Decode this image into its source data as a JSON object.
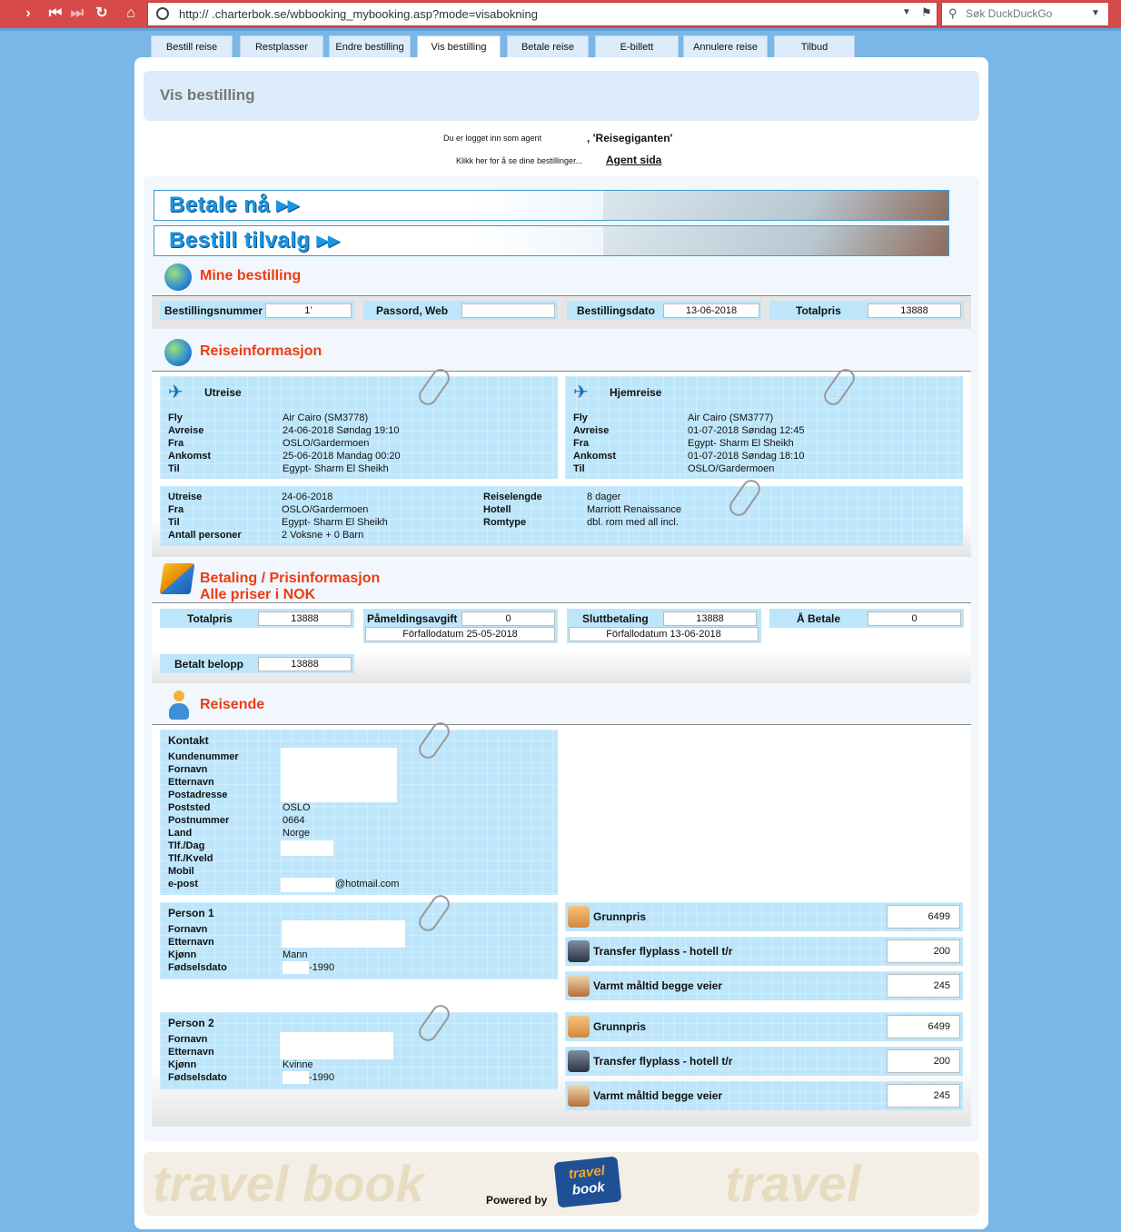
{
  "browser": {
    "url": "http://                     .charterbok.se/wbbooking_mybooking.asp?mode=visabokning",
    "search_placeholder": "Søk DuckDuckGo"
  },
  "tabs": [
    "Bestill reise",
    "Restplasser",
    "Endre bestilling",
    "Vis bestilling",
    "Betale reise",
    "E-billett",
    "Annulere reise",
    "Tilbud"
  ],
  "page_title": "Vis bestilling",
  "agent": {
    "logged_in_text": "Du er logget inn som agent",
    "agent_name": ", 'Reisegiganten'",
    "link_prompt": "Klikk her for å se dine bestillinger...",
    "link_text": "Agent sida"
  },
  "banners": {
    "pay_now": "Betale nå ▸▸",
    "order_extras": "Bestill tilvalg ▸▸"
  },
  "mine_bestilling": {
    "title": "Mine bestilling",
    "fields": [
      {
        "label": "Bestillingsnummer",
        "value": "1’"
      },
      {
        "label": "Passord, Web",
        "value": ""
      },
      {
        "label": "Bestillingsdato",
        "value": "13-06-2018"
      },
      {
        "label": "Totalpris",
        "value": "13888"
      }
    ]
  },
  "reiseinfo": {
    "title": "Reiseinformasjon",
    "utreise": {
      "heading": "Utreise",
      "labels": [
        "Fly",
        "Avreise",
        "Fra",
        "Ankomst",
        "Til"
      ],
      "values": [
        "Air Cairo (SM3778)",
        "24-06-2018 Søndag 19:10",
        "OSLO/Gardermoen",
        "25-06-2018 Mandag 00:20",
        "Egypt- Sharm El Sheikh"
      ]
    },
    "hjemreise": {
      "heading": "Hjemreise",
      "labels": [
        "Fly",
        "Avreise",
        "Fra",
        "Ankomst",
        "Til"
      ],
      "values": [
        "Air Cairo (SM3777)",
        "01-07-2018 Søndag 12:45",
        "Egypt- Sharm El Sheikh",
        "01-07-2018 Søndag 18:10",
        "OSLO/Gardermoen"
      ]
    },
    "summary_left": {
      "labels": [
        "Utreise",
        "Fra",
        "Til",
        "Antall personer"
      ],
      "values": [
        "24-06-2018",
        "OSLO/Gardermoen",
        "Egypt- Sharm El Sheikh",
        "2 Voksne + 0 Barn"
      ]
    },
    "summary_right": {
      "labels": [
        "Reiselengde",
        "Hotell",
        "Romtype"
      ],
      "values": [
        "8 dager",
        "Marriott Renaissance",
        "dbl. rom med all incl."
      ]
    }
  },
  "betaling": {
    "title_line1": "Betaling / Prisinformasjon",
    "title_line2": "Alle priser i NOK",
    "totalpris_label": "Totalpris",
    "totalpris_value": "13888",
    "pamelding_label": "Påmeldingsavgift",
    "pamelding_value": "0",
    "pamelding_due": "Förfallodatum 25-05-2018",
    "slutt_label": "Sluttbetaling",
    "slutt_value": "13888",
    "slutt_due": "Förfallodatum 13-06-2018",
    "abetale_label": "Å Betale",
    "abetale_value": "0",
    "betalt_label": "Betalt belopp",
    "betalt_value": "13888"
  },
  "reisende": {
    "title": "Reisende",
    "kontakt": {
      "heading": "Kontakt",
      "labels": [
        "Kundenummer",
        "Fornavn",
        "Etternavn",
        "Postadresse",
        "Poststed",
        "Postnummer",
        "Land",
        "Tlf./Dag",
        "Tlf./Kveld",
        "Mobil",
        "e-post"
      ],
      "poststed": "OSLO",
      "postnummer": "0664",
      "land": "Norge",
      "email_suffix": "@hotmail.com"
    },
    "persons": [
      {
        "heading": "Person 1",
        "labels": [
          "Fornavn",
          "Etternavn",
          "Kjønn",
          "Fødselsdato"
        ],
        "kjonn": "Mann",
        "birth_suffix": "-1990",
        "prices": [
          {
            "label": "Grunnpris",
            "value": "6499"
          },
          {
            "label": "Transfer flyplass - hotell t/r",
            "value": "200"
          },
          {
            "label": "Varmt måltid begge veier",
            "value": "245"
          }
        ]
      },
      {
        "heading": "Person 2",
        "labels": [
          "Fornavn",
          "Etternavn",
          "Kjønn",
          "Fødselsdato"
        ],
        "kjonn": "Kvinne",
        "birth_suffix": "-1990",
        "prices": [
          {
            "label": "Grunnpris",
            "value": "6499"
          },
          {
            "label": "Transfer flyplass - hotell t/r",
            "value": "200"
          },
          {
            "label": "Varmt måltid begge veier",
            "value": "245"
          }
        ]
      }
    ]
  },
  "footer": {
    "powered_by": "Powered by",
    "logo_line1": "travel",
    "logo_line2": "book",
    "watermark": "travel book"
  }
}
